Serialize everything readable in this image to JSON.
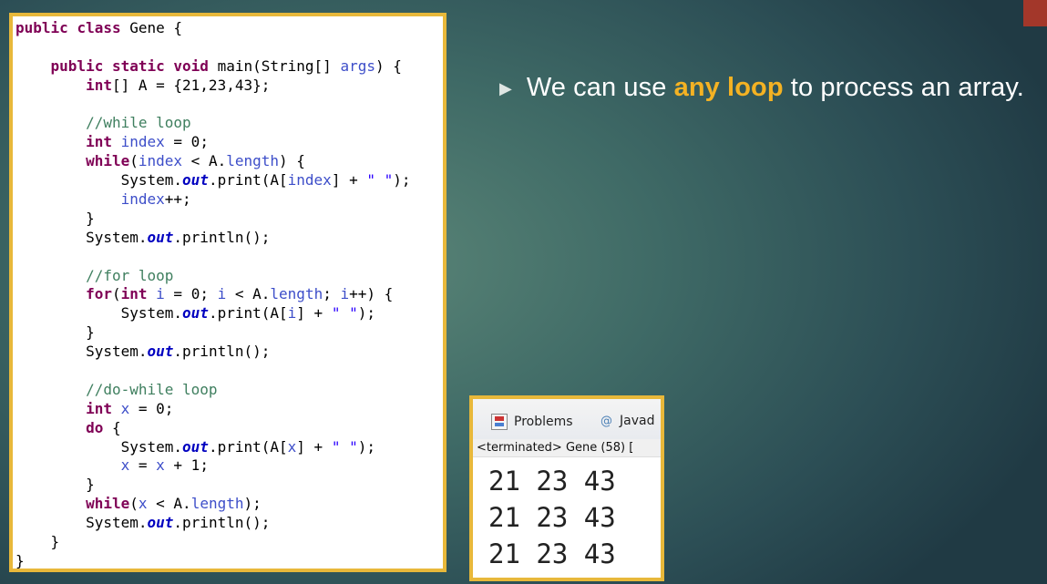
{
  "code_lines": [
    "public class Gene {",
    "",
    "    public static void main(String[] args) {",
    "        int[] A = {21,23,43};",
    "",
    "        //while loop",
    "        int index = 0;",
    "        while(index < A.length) {",
    "            System.out.print(A[index] + \" \");",
    "            index++;",
    "        }",
    "        System.out.println();",
    "",
    "        //for loop",
    "        for(int i = 0; i < A.length; i++) {",
    "            System.out.print(A[i] + \" \");",
    "        }",
    "        System.out.println();",
    "",
    "        //do-while loop",
    "        int x = 0;",
    "        do {",
    "            System.out.print(A[x] + \" \");",
    "            x = x + 1;",
    "        }",
    "        while(x < A.length);",
    "        System.out.println();",
    "    }",
    "}"
  ],
  "bullet": {
    "prefix": "We can use ",
    "highlight": "any loop",
    "suffix": " to process an array.",
    "highlight_color": "#f4b223"
  },
  "console": {
    "tab_problems": "Problems",
    "tab_javadoc": "Javad",
    "terminated_label": "<terminated> Gene (58) [",
    "output_lines": [
      "21 23 43",
      "21 23 43",
      "21 23 43"
    ]
  },
  "colors": {
    "panel_border": "#e8b83a",
    "corner_accent": "#a3372a"
  }
}
